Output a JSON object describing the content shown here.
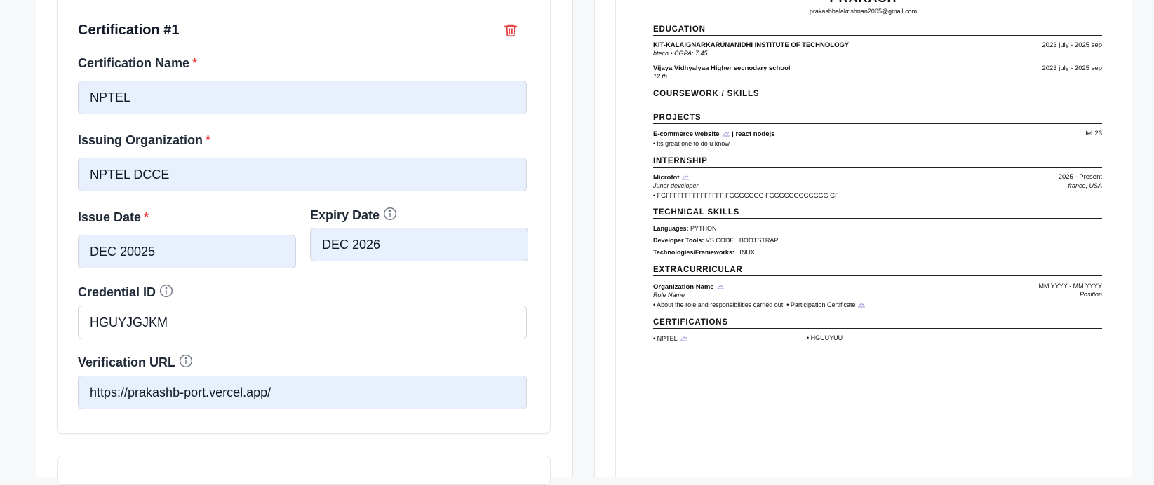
{
  "form": {
    "card_title": "Certification #1",
    "certification_name": {
      "label": "Certification Name",
      "required": "*",
      "value": "NPTEL"
    },
    "issuing_org": {
      "label": "Issuing Organization",
      "required": "*",
      "value": "NPTEL DCCE"
    },
    "issue_date": {
      "label": "Issue Date",
      "required": "*",
      "value": "DEC 20025"
    },
    "expiry_date": {
      "label": "Expiry Date",
      "value": "DEC 2026"
    },
    "credential_id": {
      "label": "Credential ID",
      "value": "HGUYJGJKM"
    },
    "verification_url": {
      "label": "Verification URL",
      "value": "https://prakashb-port.vercel.app/"
    }
  },
  "resume": {
    "name": "PRAKASH",
    "email": "prakashbalakrishnan2005@gmail.com",
    "education": {
      "heading": "EDUCATION",
      "items": [
        {
          "school": "KIT-KALAIGNARKARUNANIDHI INSTITUTE OF TECHNOLOGY",
          "detail": "btech • CGPA: 7.45",
          "dates": "2023 july - 2025 sep"
        },
        {
          "school": "Vijaya Vidhyalyaa Higher secnodary school",
          "detail": "12 th",
          "dates": "2023 july - 2025 sep"
        }
      ]
    },
    "coursework": {
      "heading": "COURSEWORK / SKILLS"
    },
    "projects": {
      "heading": "PROJECTS",
      "title": "E-commerce website",
      "tech": "| react nodejs",
      "date": "feb23",
      "bullet": "• its great one to do u know"
    },
    "internship": {
      "heading": "INTERNSHIP",
      "company": "Microfot",
      "dates": "2025 - Present",
      "role": "Junor developer",
      "location": "france, USA",
      "bullet": "• FGFFFFFFFFFFFFFFF FGGGGGGG FGGGGGGGGGGGG GF"
    },
    "technical_skills": {
      "heading": "TECHNICAL SKILLS",
      "rows": [
        {
          "label": "Languages:",
          "value": "PYTHON"
        },
        {
          "label": "Developer Tools:",
          "value": "VS CODE , BOOTSTRAP"
        },
        {
          "label": "Technologies/Frameworks:",
          "value": "LINUX"
        }
      ]
    },
    "extracurricular": {
      "heading": "EXTRACURRICULAR",
      "org": "Organization Name",
      "dates": "MM YYYY - MM YYYY",
      "role": "Role Name",
      "position": "Position",
      "bullet": "• About the role and responsibilities carried out. • Participation Certificate"
    },
    "certifications": {
      "heading": "CERTIFICATIONS",
      "col1": "• NPTEL",
      "col2": "• HGUUYUU"
    }
  },
  "colors": {
    "accent_blue_field": "#e8effd",
    "required_red": "#ef4444",
    "trash_red": "#e53e3e",
    "link_purple": "#9f96d9"
  },
  "icons": [
    "trash-icon",
    "info-icon",
    "link-icon"
  ]
}
